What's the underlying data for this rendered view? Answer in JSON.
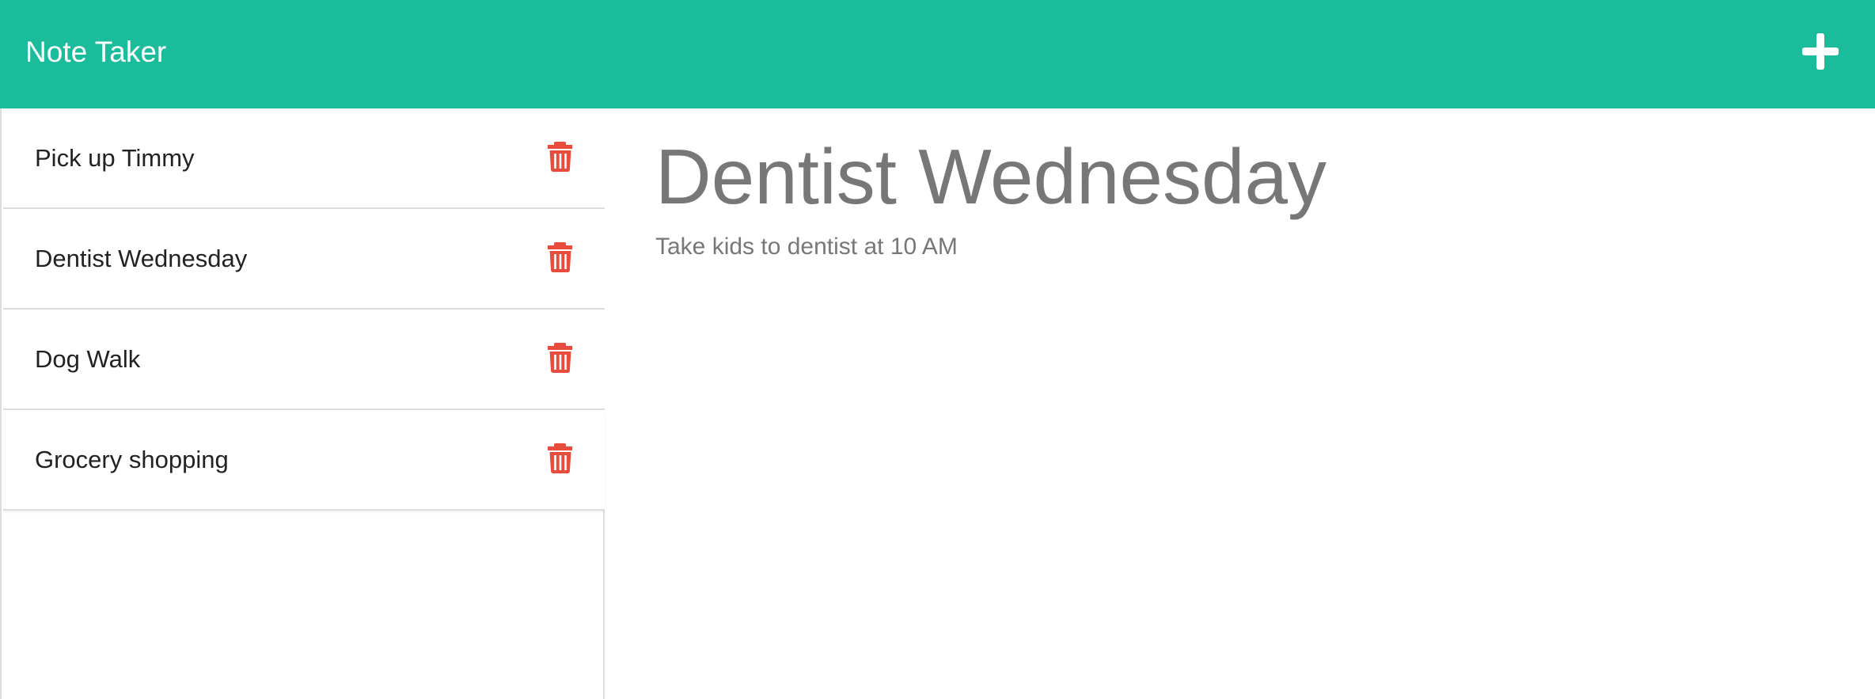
{
  "app": {
    "brand": "Note Taker",
    "accent_color": "#1abc9c",
    "delete_color": "#e74c3c",
    "new_note_icon": "plus-icon",
    "delete_icon": "trash-icon"
  },
  "notes": [
    {
      "title": "Pick up Timmy"
    },
    {
      "title": "Dentist Wednesday"
    },
    {
      "title": "Dog Walk"
    },
    {
      "title": "Grocery shopping"
    }
  ],
  "active_note": {
    "title": "Dentist Wednesday",
    "text": "Take kids to dentist at 10 AM"
  }
}
